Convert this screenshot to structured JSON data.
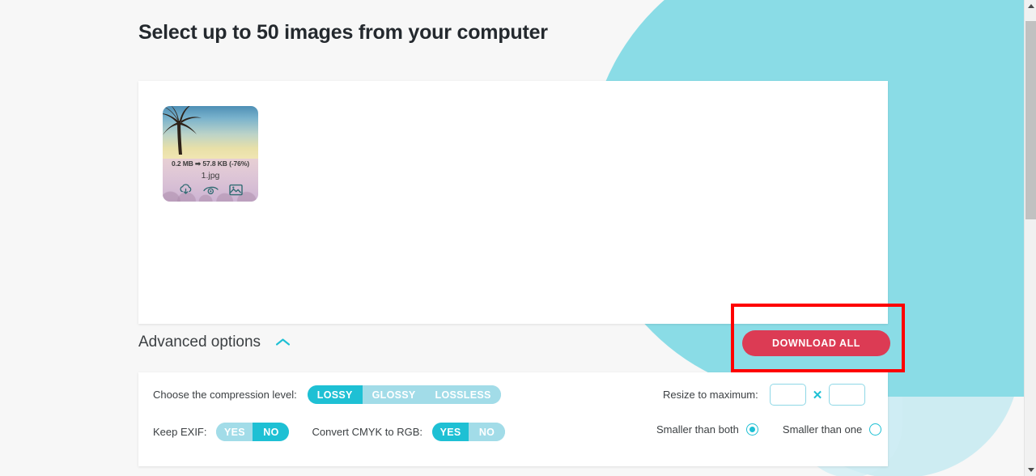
{
  "page": {
    "title": "Select up to 50 images from your computer",
    "background_color": "#f7f7f7",
    "accent_color": "#1ec0d4",
    "accent_light_color": "#a2dce8",
    "download_color": "#dc3b54",
    "annotation_color": "#fe0000"
  },
  "files_card": {
    "items": [
      {
        "size_text": "0.2 MB ➡ 57.8 KB (-76%)",
        "original_size": "0.2 MB",
        "compressed_size": "57.8 KB",
        "savings": "(-76%)",
        "filename": "1.jpg",
        "icons": [
          "download-cloud-icon",
          "eye-icon",
          "image-icon"
        ]
      }
    ]
  },
  "download_all": {
    "label": "DOWNLOAD ALL"
  },
  "advanced_options": {
    "label": "Advanced options",
    "toggle_icon": "chevron-up-icon",
    "compression": {
      "label": "Choose the compression level:",
      "options": [
        "LOSSY",
        "GLOSSY",
        "LOSSLESS"
      ],
      "selected": "LOSSY"
    },
    "keep_exif": {
      "label": "Keep EXIF:",
      "options": [
        "YES",
        "NO"
      ],
      "selected": "NO"
    },
    "cmyk": {
      "label": "Convert CMYK to RGB:",
      "options": [
        "YES",
        "NO"
      ],
      "selected": "YES"
    },
    "resize": {
      "label": "Resize to maximum:",
      "width_value": "",
      "height_value": "",
      "separator": "✕"
    },
    "resize_mode": {
      "options": [
        {
          "label": "Smaller than both",
          "selected": true
        },
        {
          "label": "Smaller than one",
          "selected": false
        }
      ]
    }
  },
  "scrollbar": {
    "up_icon": "scroll-up-arrow-icon",
    "down_icon": "scroll-down-arrow-icon"
  }
}
